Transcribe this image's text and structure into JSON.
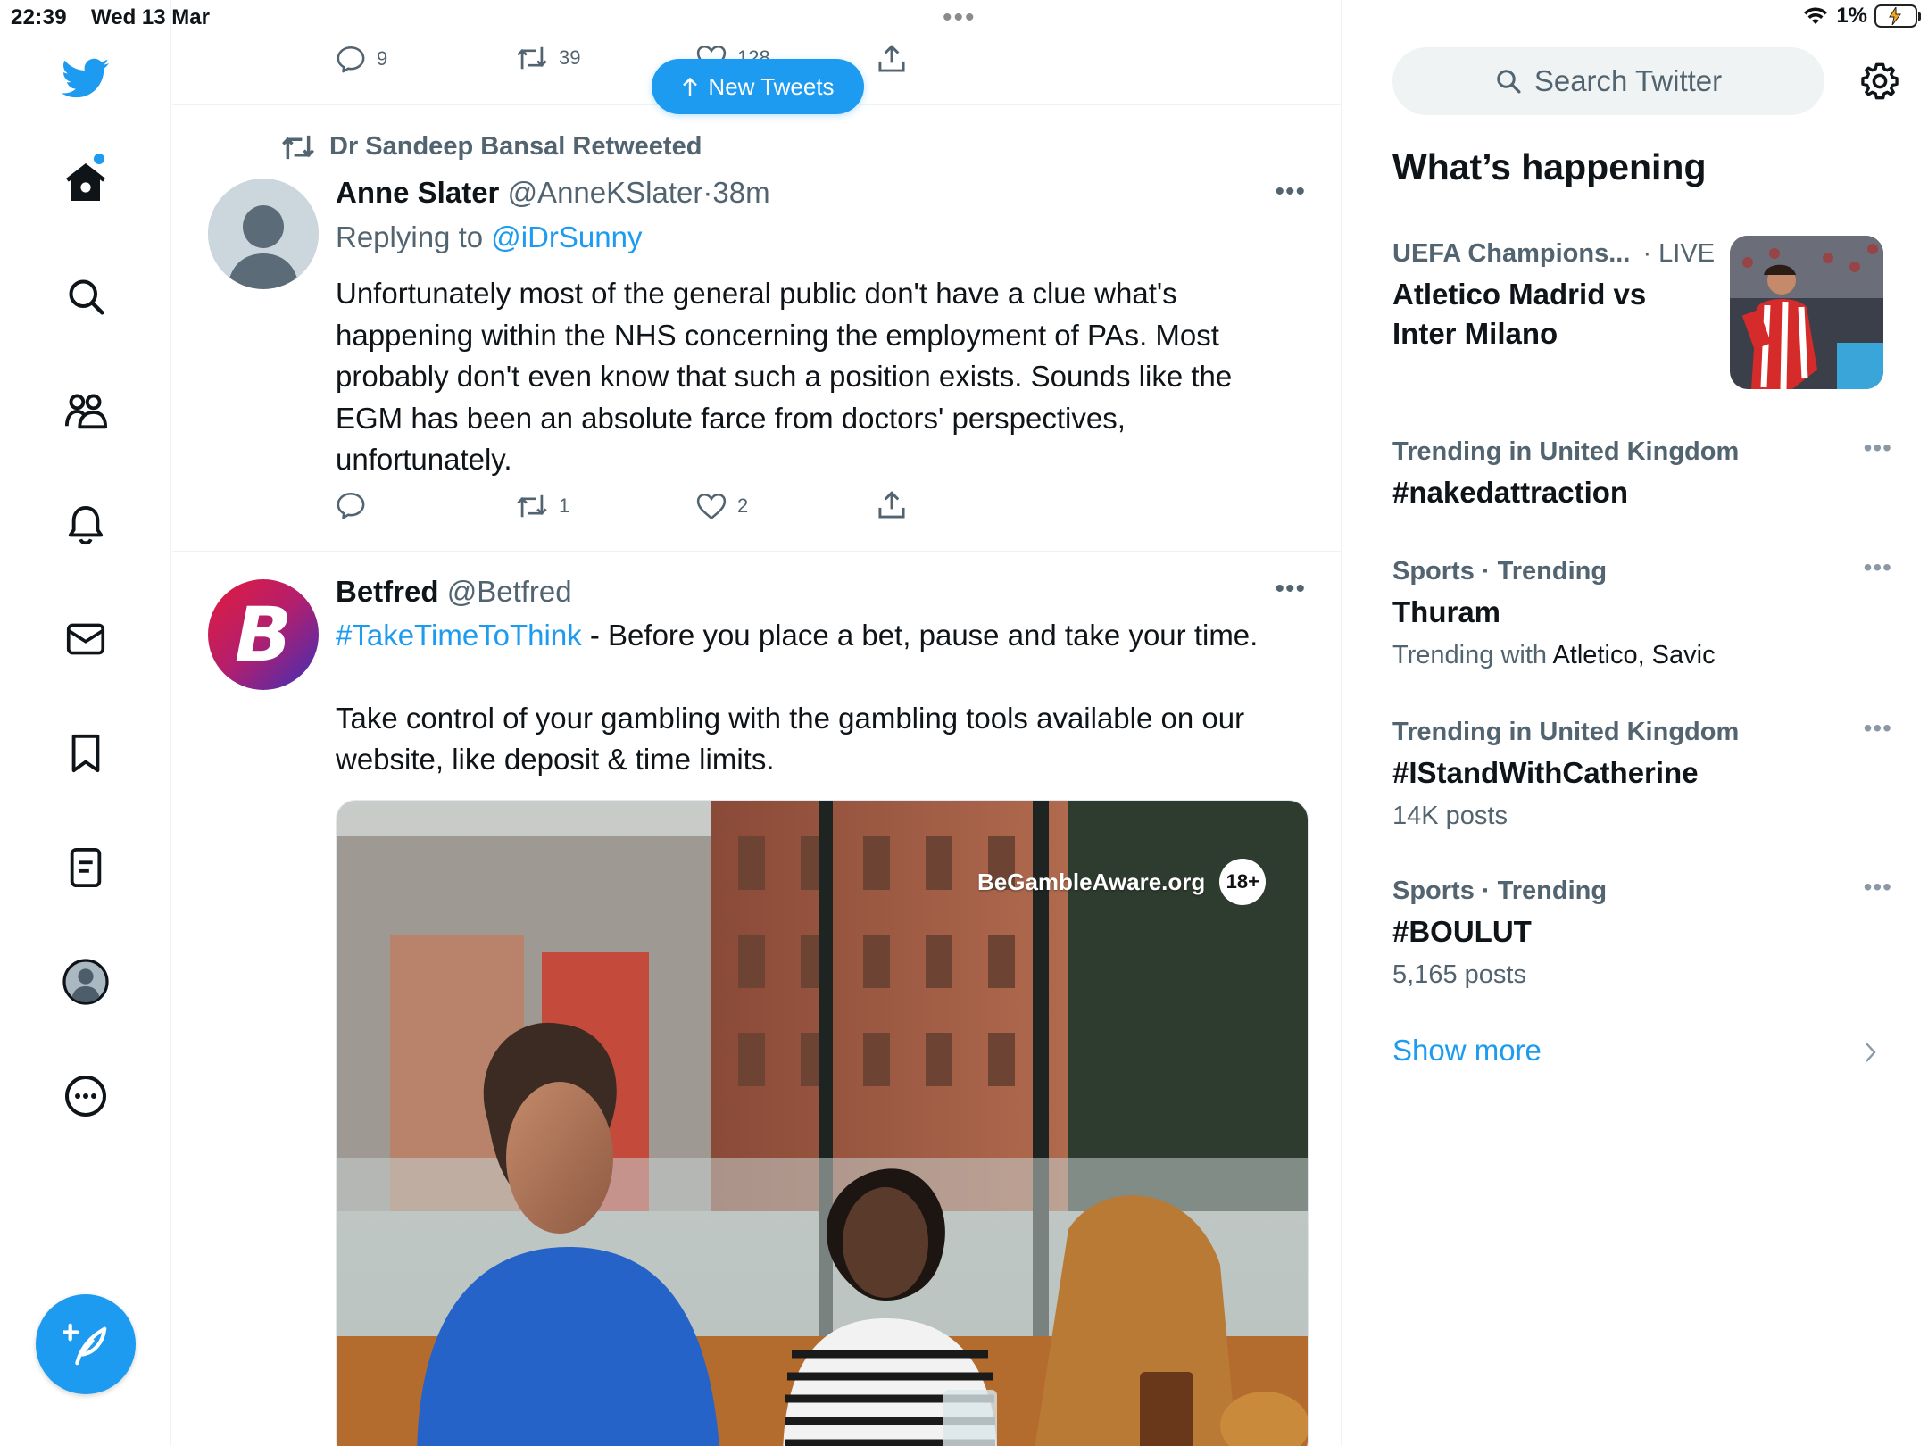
{
  "status_bar": {
    "time": "22:39",
    "date": "Wed 13 Mar",
    "battery": "1%"
  },
  "nav": {
    "items": [
      "twitter-logo",
      "home",
      "explore",
      "communities",
      "notifications",
      "messages",
      "bookmarks",
      "lists",
      "profile",
      "more"
    ]
  },
  "new_tweets_label": "New Tweets",
  "prev_tweet": {
    "replies": "9",
    "retweets": "39",
    "likes": "128"
  },
  "tweets": [
    {
      "retweeted_by": "Dr Sandeep Bansal Retweeted",
      "name": "Anne Slater",
      "handle": "@AnneKSlater",
      "separator": "·",
      "time": "38m",
      "replying_prefix": "Replying to ",
      "replying_handle": "@iDrSunny",
      "text": "Unfortunately most of the general public don't have a clue what's happening within the NHS concerning the employment of PAs. Most probably don't even know that such a position exists. Sounds like the EGM has been an absolute farce from doctors' perspectives, unfortunately.",
      "replies": "",
      "retweets": "1",
      "likes": "2"
    },
    {
      "name": "Betfred",
      "handle": "@Betfred",
      "hashtag": "#TakeTimeToThink",
      "text_after_hashtag": " - Before you place a bet, pause and take your time.",
      "text_para2": "Take control of your gambling with the gambling tools available on our website, like deposit & time limits.",
      "avatar_letter": "B",
      "media_watermark": "BeGambleAware.org",
      "media_badge": "18+"
    }
  ],
  "sidebar": {
    "search_placeholder": "Search Twitter",
    "section_title": "What’s happening",
    "live": {
      "meta": "UEFA Champions...",
      "live_label": "· LIVE",
      "title": "Atletico Madrid vs Inter Milano"
    },
    "trends": [
      {
        "meta": "Trending in United Kingdom",
        "title": "#nakedattraction",
        "sub_prefix": "",
        "sub_strong": ""
      },
      {
        "meta": "Sports · Trending",
        "title": "Thuram",
        "sub_prefix": "Trending with ",
        "sub_strong": "Atletico, Savic"
      },
      {
        "meta": "Trending in United Kingdom",
        "title": "#IStandWithCatherine",
        "sub_prefix": "14K posts",
        "sub_strong": ""
      },
      {
        "meta": "Sports · Trending",
        "title": "#BOULUT",
        "sub_prefix": "5,165 posts",
        "sub_strong": ""
      }
    ],
    "show_more": "Show more"
  },
  "colors": {
    "accent": "#1d9bf0",
    "text_primary": "#0f1419",
    "text_secondary": "#536471",
    "betfred_gradient_start": "#d31c4e",
    "betfred_gradient_end": "#3d2fb8"
  }
}
